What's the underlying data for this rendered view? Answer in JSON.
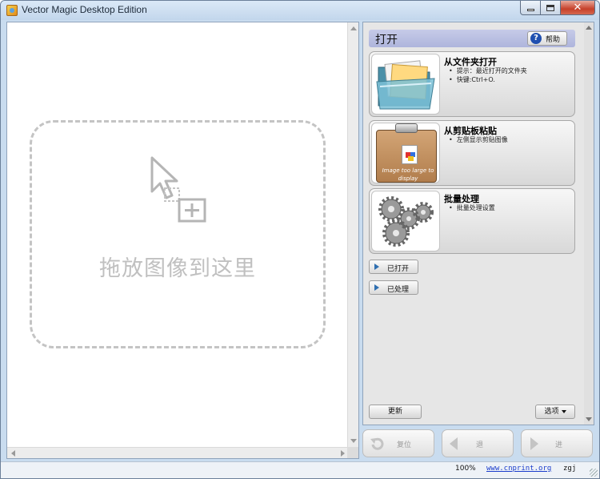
{
  "window": {
    "title": "Vector Magic Desktop Edition",
    "close_glyph": "✕"
  },
  "canvas": {
    "drop_text": "拖放图像到这里"
  },
  "panel": {
    "title": "打开",
    "help_icon_glyph": "?",
    "help_label": "帮助",
    "cards": [
      {
        "title": "从文件夹打开",
        "bullets": [
          "提示：最近打开的文件夹",
          "快键:Ctrl+O."
        ]
      },
      {
        "title": "从剪贴板粘贴",
        "bullets": [
          "左侧显示剪贴图像"
        ],
        "thumb_text": "Image too large to display"
      },
      {
        "title": "批量处理",
        "bullets": [
          "批量处理设置"
        ]
      }
    ],
    "expanders": [
      {
        "label": "已打开"
      },
      {
        "label": "已处理"
      }
    ],
    "update_label": "更新",
    "options_label": "选项"
  },
  "nav": {
    "reset_label": "复位",
    "back_label": "退",
    "forward_label": "进"
  },
  "status": {
    "zoom": "100%",
    "link": "www.cnprint.org",
    "user": "zgj"
  },
  "colors": {
    "accent_header": "#b4bbe0",
    "link": "#1a3ccc",
    "close_button": "#c6402a"
  },
  "icons": [
    "app-icon",
    "help-icon",
    "folder-icon",
    "clipboard-icon",
    "gears-icon",
    "reset-icon",
    "back-arrow-icon",
    "forward-arrow-icon",
    "drop-cursor-icon"
  ]
}
